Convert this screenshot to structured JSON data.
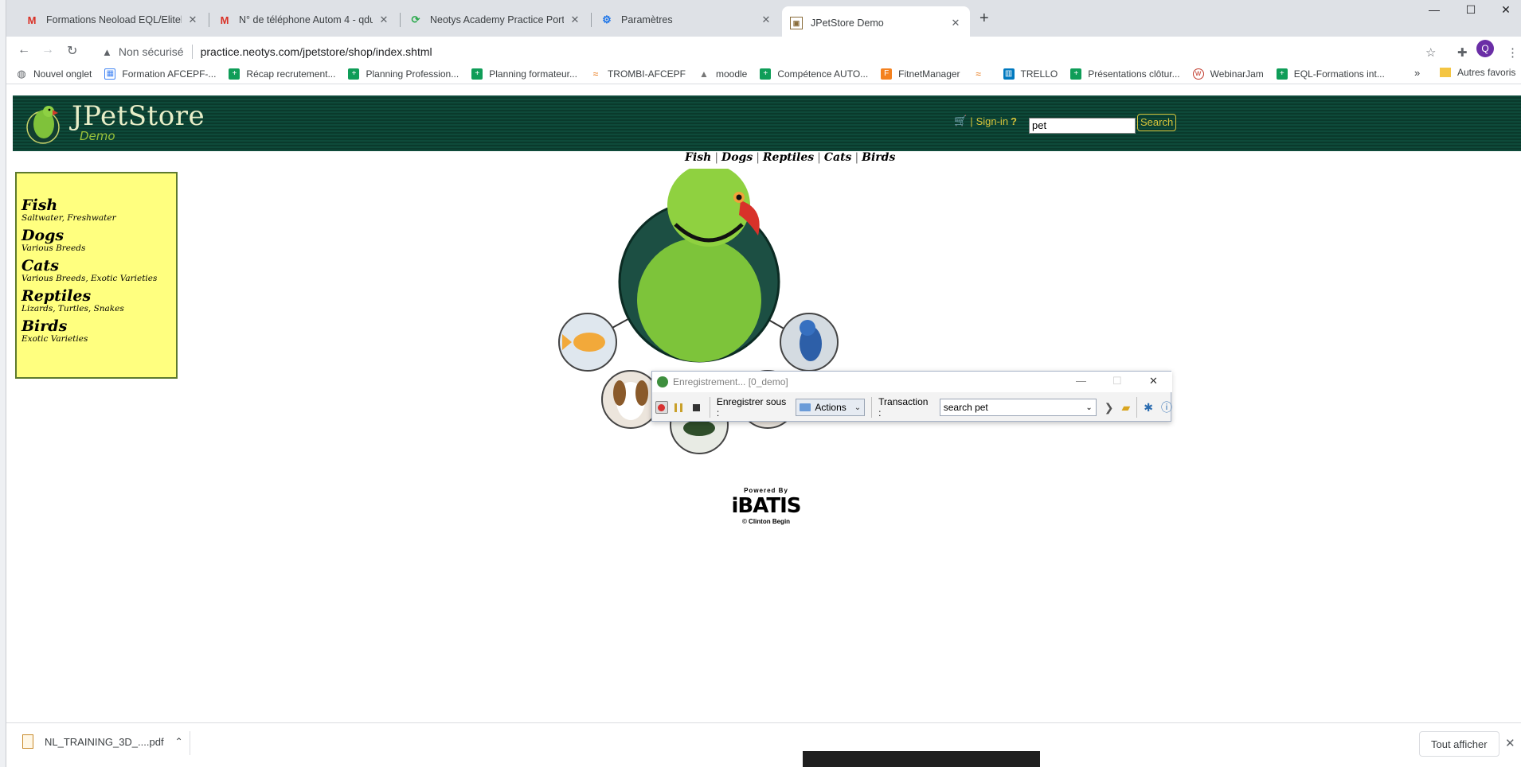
{
  "browser": {
    "tabs": [
      {
        "label": "Formations Neoload EQL/Elitek -",
        "icon": "gmail-icon"
      },
      {
        "label": "N° de téléphone Autom 4 - qdu",
        "icon": "gmail-icon"
      },
      {
        "label": "Neotys Academy Practice Portal",
        "icon": "neotys-icon"
      },
      {
        "label": "Paramètres",
        "icon": "gear-icon"
      },
      {
        "label": "JPetStore Demo",
        "icon": "page-icon"
      }
    ],
    "security_label": "Non sécurisé",
    "url": "practice.neotys.com/jpetstore/shop/index.shtml",
    "profile_initial": "Q",
    "bookmarks": [
      {
        "label": "Nouvel onglet",
        "color": "#5f6368"
      },
      {
        "label": "Formation AFCEPF-...",
        "color": "#4285f4"
      },
      {
        "label": "Récap recrutement...",
        "color": "#0f9d58"
      },
      {
        "label": "Planning Profession...",
        "color": "#0f9d58"
      },
      {
        "label": "Planning formateur...",
        "color": "#0f9d58"
      },
      {
        "label": "TROMBI-AFCEPF",
        "color": "#e8710a"
      },
      {
        "label": "moodle",
        "color": "#777777"
      },
      {
        "label": "Compétence AUTO...",
        "color": "#0f9d58"
      },
      {
        "label": "FitnetManager",
        "color": "#f4811f"
      },
      {
        "label": "",
        "color": "#e8710a"
      },
      {
        "label": "TRELLO",
        "color": "#0079bf"
      },
      {
        "label": "Présentations clôtur...",
        "color": "#0f9d58"
      },
      {
        "label": "WebinarJam",
        "color": "#c0392b"
      },
      {
        "label": "EQL-Formations int...",
        "color": "#0f9d58"
      }
    ],
    "bookmarks_more": "»",
    "other_bookmarks": "Autres favoris"
  },
  "page": {
    "logo_title": "JPetStore",
    "logo_subtitle": "Demo",
    "signin_label": "Sign-in",
    "help_label": "?",
    "search_value": "pet",
    "search_button": "Search",
    "quicklinks": [
      "Fish",
      "Dogs",
      "Reptiles",
      "Cats",
      "Birds"
    ],
    "categories": [
      {
        "name": "Fish",
        "desc": "Saltwater, Freshwater"
      },
      {
        "name": "Dogs",
        "desc": "Various Breeds"
      },
      {
        "name": "Cats",
        "desc": "Various Breeds, Exotic Varieties"
      },
      {
        "name": "Reptiles",
        "desc": "Lizards, Turtles, Snakes"
      },
      {
        "name": "Birds",
        "desc": "Exotic Varieties"
      }
    ],
    "powered_by": "Powered By",
    "ibatis": "iBATIS",
    "clinton": "© Clinton Begin"
  },
  "recorder": {
    "title": "Enregistrement... [0_demo]",
    "save_under_label": "Enregistrer sous :",
    "save_under_value": "Actions",
    "transaction_label": "Transaction :",
    "transaction_value": "search pet"
  },
  "downloads": {
    "file_name": "NL_TRAINING_3D_....pdf",
    "show_all": "Tout afficher"
  }
}
